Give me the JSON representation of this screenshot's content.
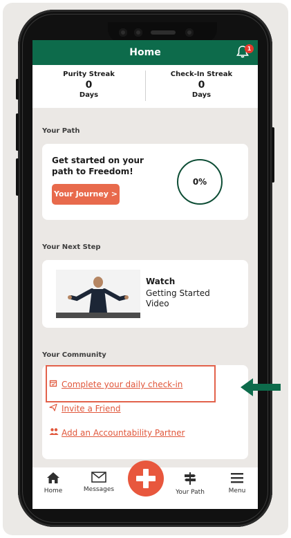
{
  "header": {
    "title": "Home",
    "notification_count": "1"
  },
  "streaks": [
    {
      "label": "Purity Streak",
      "value": "0",
      "unit": "Days"
    },
    {
      "label": "Check-In Streak",
      "value": "0",
      "unit": "Days"
    }
  ],
  "path": {
    "section_title": "Your Path",
    "headline_line1": "Get started on your",
    "headline_line2": "path to Freedom!",
    "button_label": "Your Journey >",
    "progress_label": "0%"
  },
  "next_step": {
    "section_title": "Your Next Step",
    "watch_title": "Watch",
    "watch_subtitle": "Getting Started Video"
  },
  "community": {
    "section_title": "Your Community",
    "items": [
      {
        "label": "Complete your daily check-in",
        "icon": "calendar-icon"
      },
      {
        "label": "Invite a Friend",
        "icon": "paper-plane-icon"
      },
      {
        "label": "Add an Accountability Partner",
        "icon": "people-icon"
      }
    ]
  },
  "nav": {
    "items": [
      {
        "label": "Home",
        "icon": "home-icon"
      },
      {
        "label": "Messages",
        "icon": "envelope-icon"
      },
      {
        "label": "Your Path",
        "icon": "signpost-icon"
      },
      {
        "label": "Menu",
        "icon": "hamburger-icon"
      }
    ],
    "fab_icon": "plus-icon"
  },
  "colors": {
    "brand_green": "#0d6b4b",
    "accent_orange": "#e86a4c",
    "annotation_arrow": "#0d6b4b"
  }
}
